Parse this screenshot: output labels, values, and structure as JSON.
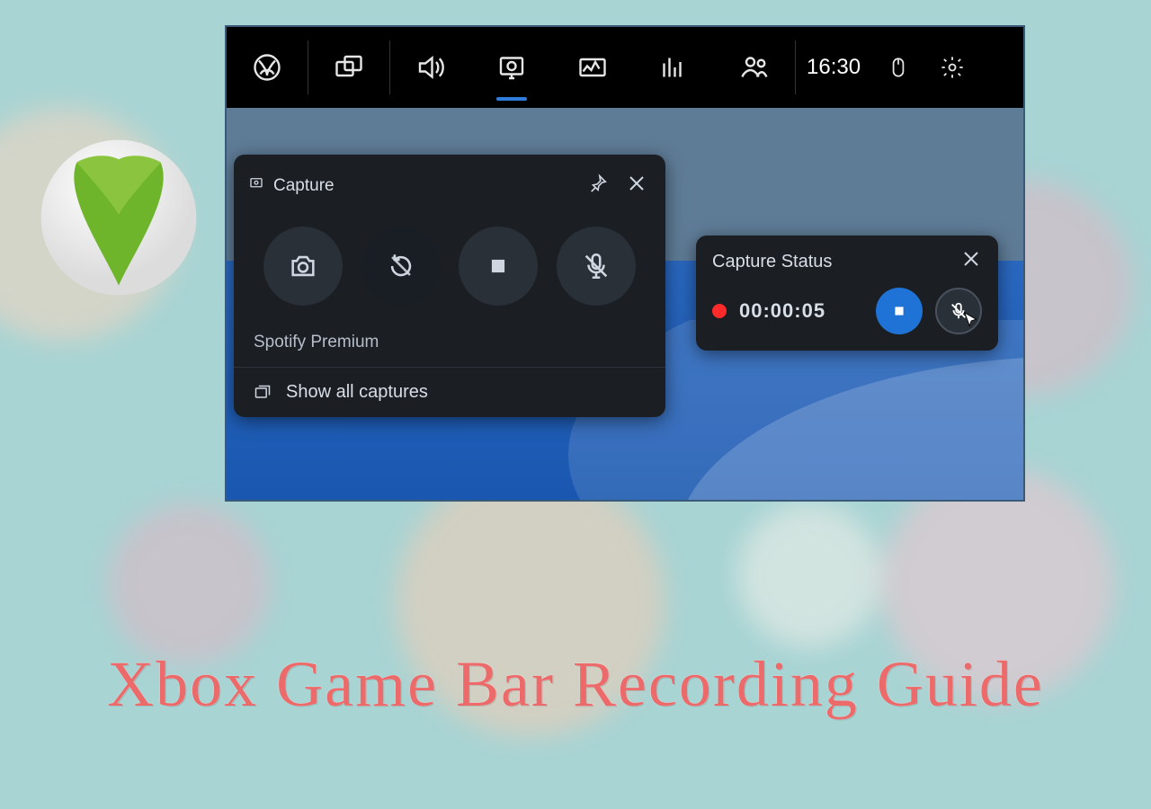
{
  "topbar": {
    "clock": "16:30"
  },
  "capture": {
    "title": "Capture",
    "app_name": "Spotify Premium",
    "show_all_label": "Show all captures"
  },
  "status": {
    "title": "Capture Status",
    "elapsed": "00:00:05"
  },
  "headline": "Xbox Game Bar Recording Guide"
}
